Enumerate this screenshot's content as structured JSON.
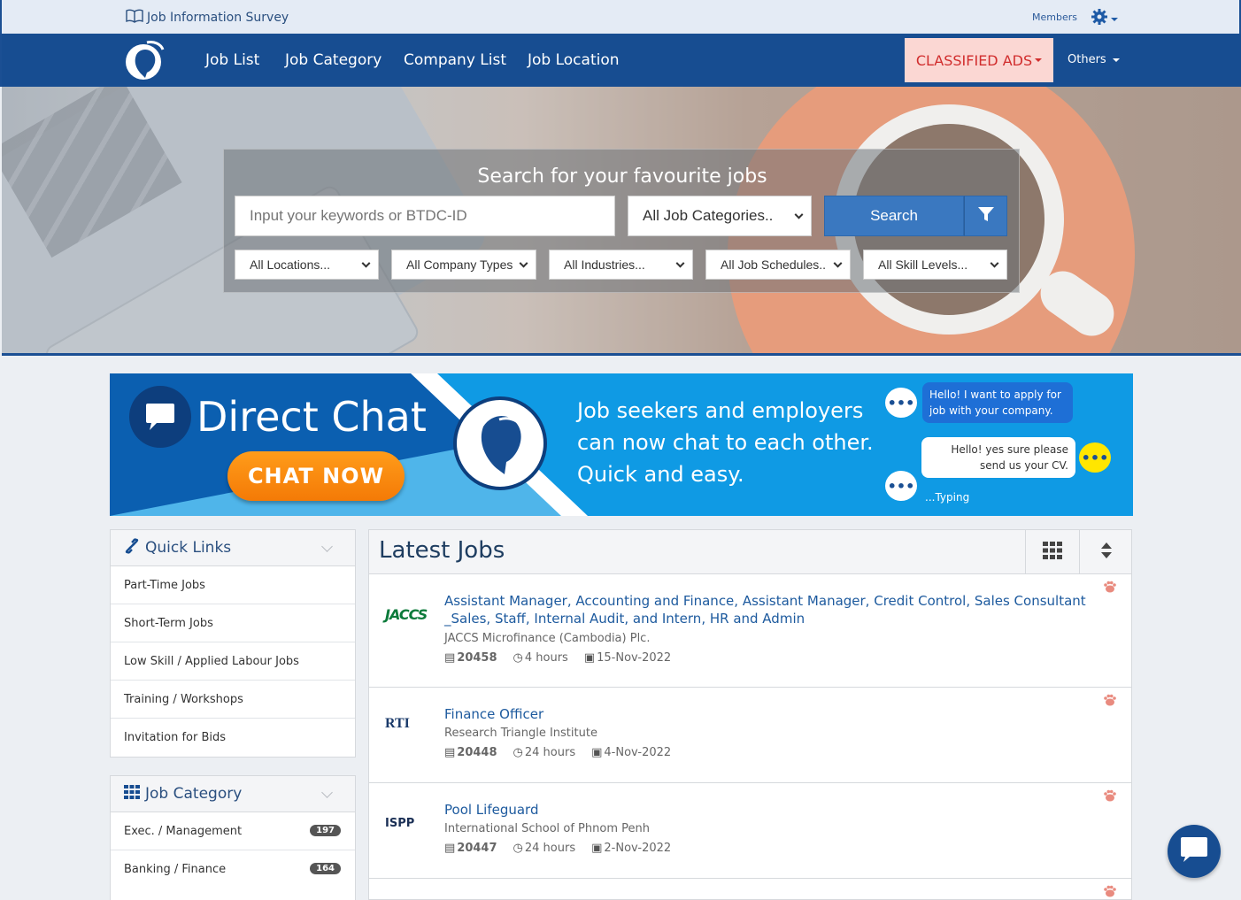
{
  "topbar": {
    "brand": "Job Information Survey",
    "members": "Members",
    "settings_icon": "gear-icon"
  },
  "nav": {
    "links": [
      "Job List",
      "Job Category",
      "Company List",
      "Job Location"
    ],
    "classified": "CLASSIFIED ADS",
    "others": "Others"
  },
  "search": {
    "title": "Search for your favourite jobs",
    "keyword_placeholder": "Input your keywords or BTDC-ID",
    "category": "All Job Categories..",
    "button": "Search",
    "filters": [
      "All Locations...",
      "All Company Types",
      "All Industries...",
      "All Job Schedules..",
      "All Skill Levels..."
    ]
  },
  "banner": {
    "heading": "Direct Chat",
    "cta": "CHAT NOW",
    "tagline": [
      "Job seekers and employers",
      "can now chat to each other.",
      "Quick and easy."
    ],
    "bubble1": "Hello! I want to apply for job with your company.",
    "bubble2": "Hello! yes sure please send us your CV.",
    "typing": "...Typing"
  },
  "quick_links": {
    "title": "Quick Links",
    "items": [
      "Part-Time Jobs",
      "Short-Term Jobs",
      "Low Skill / Applied Labour Jobs",
      "Training / Workshops",
      "Invitation for Bids"
    ]
  },
  "job_category": {
    "title": "Job Category",
    "items": [
      {
        "label": "Exec. / Management",
        "count": "197"
      },
      {
        "label": "Banking / Finance",
        "count": "164"
      }
    ]
  },
  "latest_jobs": {
    "title": "Latest Jobs",
    "jobs": [
      {
        "logo": "JACCS",
        "title": "Assistant Manager, Accounting and Finance, Assistant Manager, Credit Control, Sales Consultant _Sales, Staff, Internal Audit, and Intern, HR and Admin",
        "company": "JACCS Microfinance (Cambodia) Plc.",
        "id": "20458",
        "age": "4 hours",
        "date": "15-Nov-2022"
      },
      {
        "logo": "RTI",
        "title": "Finance Officer",
        "company": "Research Triangle Institute",
        "id": "20448",
        "age": "24 hours",
        "date": "4-Nov-2022"
      },
      {
        "logo": "ISPP",
        "title": "Pool Lifeguard",
        "company": "International School of Phnom Penh",
        "id": "20447",
        "age": "24 hours",
        "date": "2-Nov-2022"
      }
    ]
  },
  "colors": {
    "nav_bg": "#174d91",
    "classified_bg": "#fbd7d3",
    "classified_text": "#d12d2d",
    "search_btn": "#3a78c0",
    "link": "#1d5a9e"
  }
}
